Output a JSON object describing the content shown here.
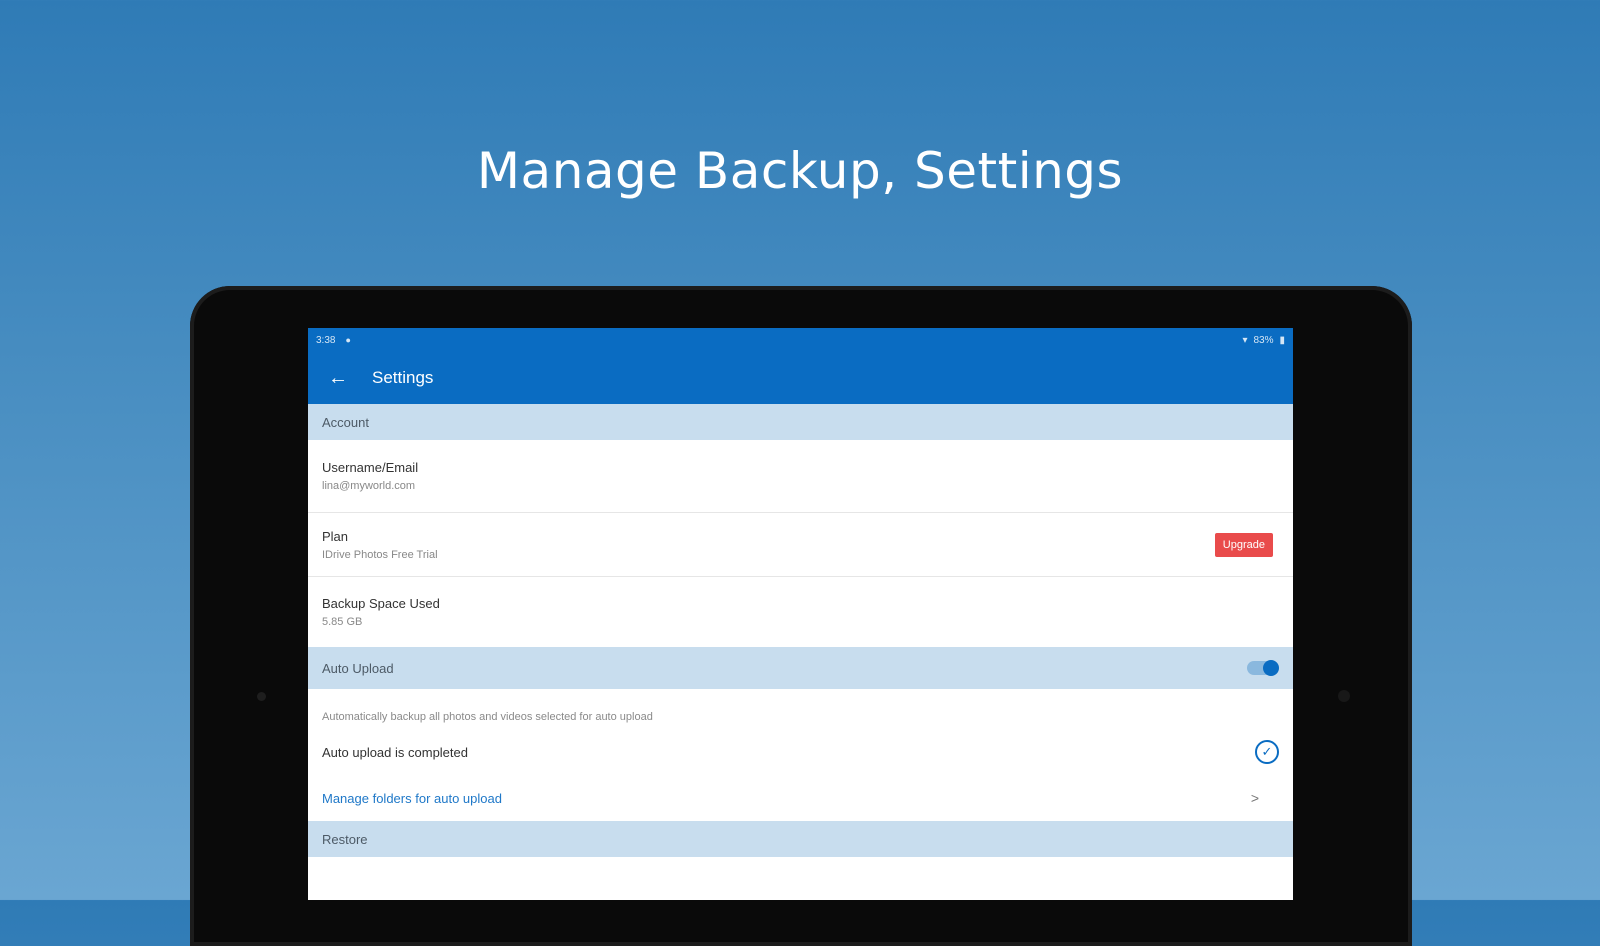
{
  "headline": "Manage Backup, Settings",
  "status_bar": {
    "time": "3:38",
    "battery": "83%"
  },
  "app_bar": {
    "title": "Settings"
  },
  "sections": {
    "account": "Account",
    "auto_upload": "Auto Upload",
    "restore": "Restore"
  },
  "account": {
    "username_label": "Username/Email",
    "username_value": "lina@myworld.com",
    "plan_label": "Plan",
    "plan_value": "IDrive Photos Free Trial",
    "upgrade_label": "Upgrade",
    "space_label": "Backup Space Used",
    "space_value": "5.85 GB"
  },
  "auto_upload": {
    "enabled": true,
    "description": "Automatically backup all photos and videos selected for auto upload",
    "status_text": "Auto upload is completed",
    "manage_link": "Manage folders for auto upload",
    "chevron": ">"
  },
  "colors": {
    "accent": "#0a6cc2",
    "section_bg": "#c8ddee",
    "upgrade": "#e94b4b"
  }
}
